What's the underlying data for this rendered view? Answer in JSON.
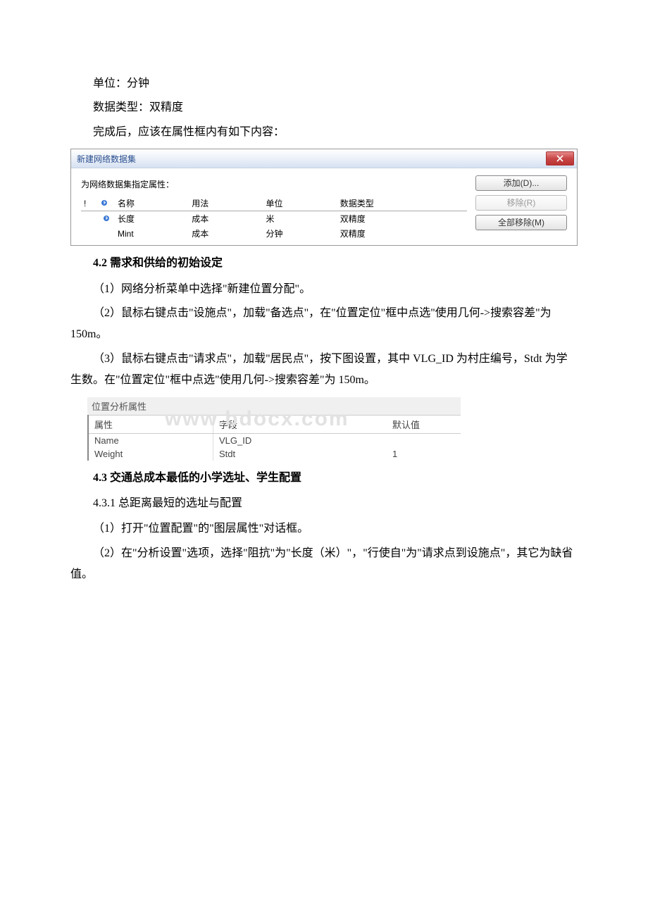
{
  "paragraphs": {
    "p1": "单位：分钟",
    "p2": "数据类型：双精度",
    "p3": "完成后，应该在属性框内有如下内容：",
    "h42": "4.2 需求和供给的初始设定",
    "p4": "（1）网络分析菜单中选择\"新建位置分配\"。",
    "p5": "（2）鼠标右键点击\"设施点\"，加载\"备选点\"，在\"位置定位\"框中点选\"使用几何->搜索容差\"为 150m。",
    "p6": "（3）鼠标右键点击\"请求点\"，加载\"居民点\"，按下图设置，其中 VLG_ID 为村庄编号，Stdt 为学生数。在\"位置定位\"框中点选\"使用几何->搜索容差\"为 150m。",
    "h43": "4.3 交通总成本最低的小学选址、学生配置",
    "sh431": "4.3.1 总距离最短的选址与配置",
    "p7": "（1）打开\"位置配置\"的\"图层属性\"对话框。",
    "p8": "（2）在\"分析设置\"选项，选择\"阻抗\"为\"长度（米）\"，\"行使自\"为\"请求点到设施点\"，其它为缺省值。"
  },
  "dialog1": {
    "title": "新建网络数据集",
    "subtitle": "为网络数据集指定属性：",
    "columns": {
      "c0": "!",
      "c1": "",
      "c2": "名称",
      "c3": "用法",
      "c4": "单位",
      "c5": "数据类型"
    },
    "rows": [
      {
        "icon": "",
        "name": "长度",
        "usage": "成本",
        "unit": "米",
        "dtype": "双精度"
      },
      {
        "icon": "",
        "name": "Mint",
        "usage": "成本",
        "unit": "分钟",
        "dtype": "双精度"
      }
    ],
    "buttons": {
      "add": "添加(D)...",
      "remove": "移除(R)",
      "removeAll": "全部移除(M)"
    }
  },
  "panel": {
    "title": "位置分析属性",
    "columns": {
      "c1": "属性",
      "c2": "字段",
      "c3": "默认值"
    },
    "rows": [
      {
        "attr": "Name",
        "field": "VLG_ID",
        "def": ""
      },
      {
        "attr": "Weight",
        "field": "Stdt",
        "def": "1"
      }
    ],
    "watermark": "www.bdocx.com"
  }
}
